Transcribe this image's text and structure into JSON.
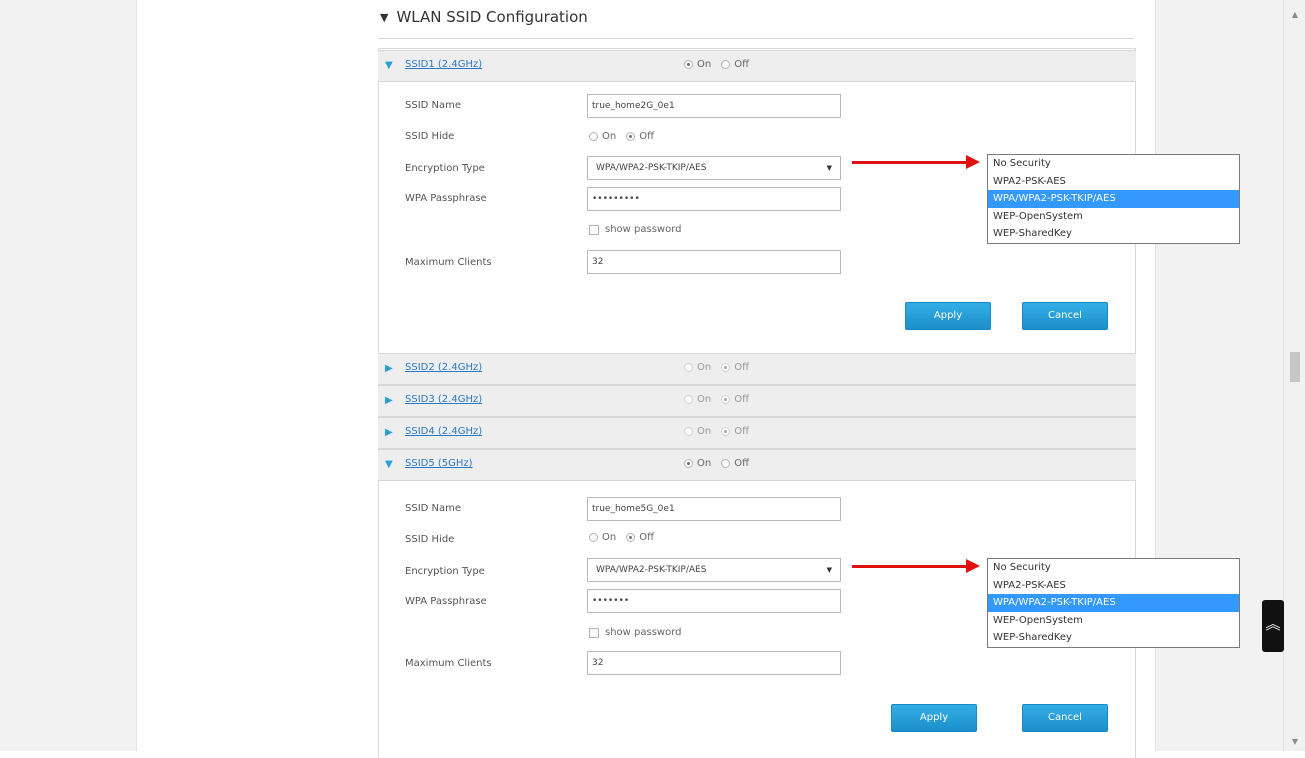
{
  "section": {
    "title": "WLAN SSID Configuration"
  },
  "ssids": [
    {
      "label": "SSID1 (2.4GHz)",
      "on": "On",
      "off": "Off"
    },
    {
      "label": "SSID2 (2.4GHz)",
      "on": "On",
      "off": "Off"
    },
    {
      "label": "SSID3 (2.4GHz)",
      "on": "On",
      "off": "Off"
    },
    {
      "label": "SSID4 (2.4GHz)",
      "on": "On",
      "off": "Off"
    },
    {
      "label": "SSID5 (5GHz)",
      "on": "On",
      "off": "Off"
    }
  ],
  "forms": [
    {
      "ssid_name_label": "SSID Name",
      "ssid_name_value": "true_home2G_0e1",
      "ssid_hide_label": "SSID Hide",
      "hide_on": "On",
      "hide_off": "Off",
      "encryption_label": "Encryption Type",
      "encryption_value": "WPA/WPA2-PSK-TKIP/AES",
      "passphrase_label": "WPA Passphrase",
      "passphrase_mask": "•••••••••",
      "show_password": "show password",
      "max_clients_label": "Maximum Clients",
      "max_clients_value": "32",
      "apply": "Apply",
      "cancel": "Cancel"
    },
    {
      "ssid_name_label": "SSID Name",
      "ssid_name_value": "true_home5G_0e1",
      "ssid_hide_label": "SSID Hide",
      "hide_on": "On",
      "hide_off": "Off",
      "encryption_label": "Encryption Type",
      "encryption_value": "WPA/WPA2-PSK-TKIP/AES",
      "passphrase_label": "WPA Passphrase",
      "passphrase_mask": "•••••••",
      "show_password": "show password",
      "max_clients_label": "Maximum Clients",
      "max_clients_value": "32",
      "apply": "Apply",
      "cancel": "Cancel"
    }
  ],
  "encryption_options": [
    "No Security",
    "WPA2-PSK-AES",
    "WPA/WPA2-PSK-TKIP/AES",
    "WEP-OpenSystem",
    "WEP-SharedKey"
  ],
  "selected_encryption": "WPA/WPA2-PSK-TKIP/AES",
  "icons": {
    "back_to_top": "double-chevron-up-icon",
    "expand": "triangle-icon",
    "annotation": "red-arrow"
  },
  "colors": {
    "accent": "#1b8fcb",
    "link": "#2b79c2",
    "highlight": "#3399ff",
    "annotation": "#e01010"
  }
}
